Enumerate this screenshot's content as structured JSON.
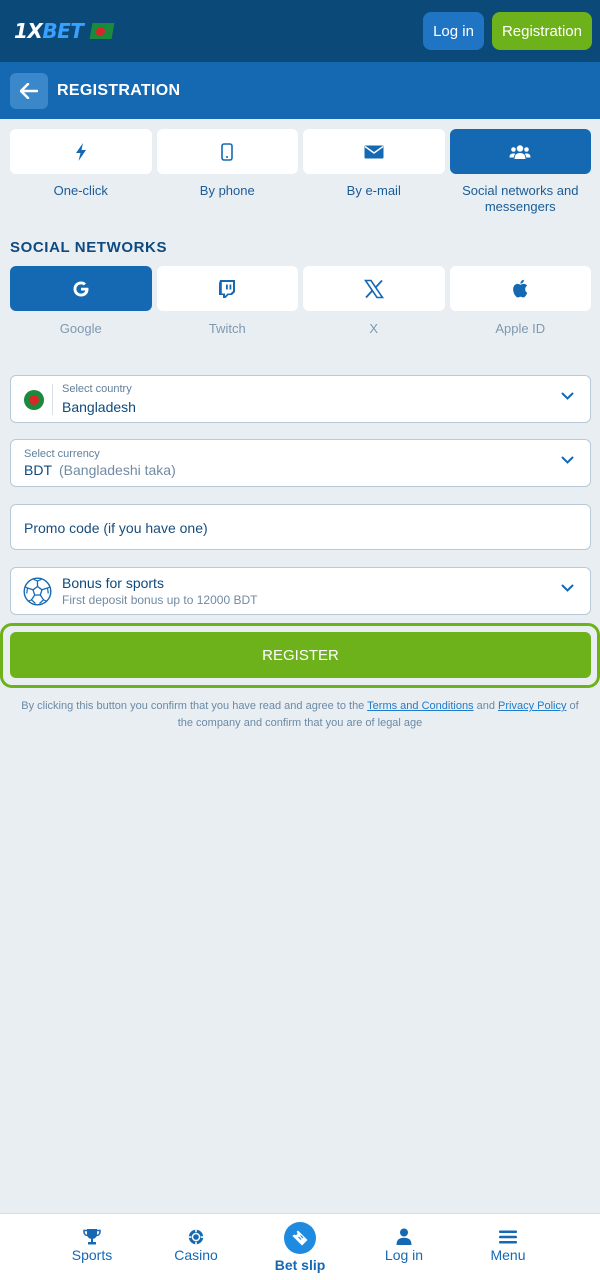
{
  "header": {
    "logo_text_a": "1X",
    "logo_text_b": "BET",
    "login_label": "Log in",
    "registration_label": "Registration"
  },
  "subheader": {
    "title": "REGISTRATION"
  },
  "tabs": [
    {
      "label": "One-click",
      "icon": "lightning-icon"
    },
    {
      "label": "By phone",
      "icon": "phone-icon"
    },
    {
      "label": "By e-mail",
      "icon": "email-icon"
    },
    {
      "label": "Social networks and messengers",
      "icon": "users-icon",
      "active": true
    }
  ],
  "social_section": {
    "title": "SOCIAL NETWORKS",
    "items": [
      {
        "label": "Google",
        "icon": "google-icon",
        "active": true
      },
      {
        "label": "Twitch",
        "icon": "twitch-icon"
      },
      {
        "label": "X",
        "icon": "x-icon"
      },
      {
        "label": "Apple ID",
        "icon": "apple-icon"
      }
    ]
  },
  "form": {
    "country_label": "Select country",
    "country_value": "Bangladesh",
    "currency_label": "Select currency",
    "currency_code": "BDT",
    "currency_name": "(Bangladeshi taka)",
    "promo_placeholder": "Promo code (if you have one)",
    "bonus_title": "Bonus for sports",
    "bonus_subtitle": "First deposit bonus up to 12000 BDT",
    "register_label": "REGISTER"
  },
  "terms": {
    "part1": "By clicking this button you confirm that you have read and agree to the ",
    "link1": "Terms and Conditions",
    "part2": " and ",
    "link2": "Privacy Policy",
    "part3": " of the company and confirm that you are of legal age"
  },
  "bottom_nav": {
    "sports": "Sports",
    "casino": "Casino",
    "betslip": "Bet slip",
    "login": "Log in",
    "menu": "Menu"
  },
  "colors": {
    "header_bg": "#0b4a78",
    "subheader_bg": "#1569b3",
    "accent_green": "#6db21a",
    "page_bg": "#e9eef3"
  }
}
